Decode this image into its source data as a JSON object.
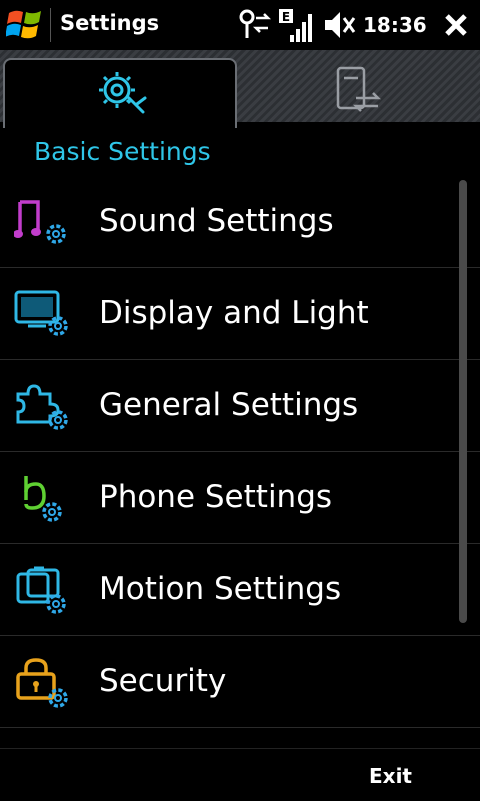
{
  "status_bar": {
    "app_title": "Settings",
    "time": "18:36",
    "network_letter": "E"
  },
  "tabs": [
    {
      "icon": "settings-gear-icon",
      "active": true
    },
    {
      "icon": "data-transfer-icon",
      "active": false
    }
  ],
  "section_header": "Basic Settings",
  "items": [
    {
      "label": "Sound Settings",
      "icon": "sound-settings-icon",
      "color": "#c23dcc"
    },
    {
      "label": "Display and Light",
      "icon": "display-settings-icon",
      "color": "#2fb8e6"
    },
    {
      "label": "General Settings",
      "icon": "general-settings-icon",
      "color": "#2fb8e6"
    },
    {
      "label": "Phone Settings",
      "icon": "phone-settings-icon",
      "color": "#5fd032"
    },
    {
      "label": "Motion Settings",
      "icon": "motion-settings-icon",
      "color": "#2fb8e6"
    },
    {
      "label": "Security",
      "icon": "security-icon",
      "color": "#e8a21c"
    }
  ],
  "softkeys": {
    "right": "Exit"
  },
  "colors": {
    "accent": "#2fc6e8",
    "background": "#000000"
  }
}
